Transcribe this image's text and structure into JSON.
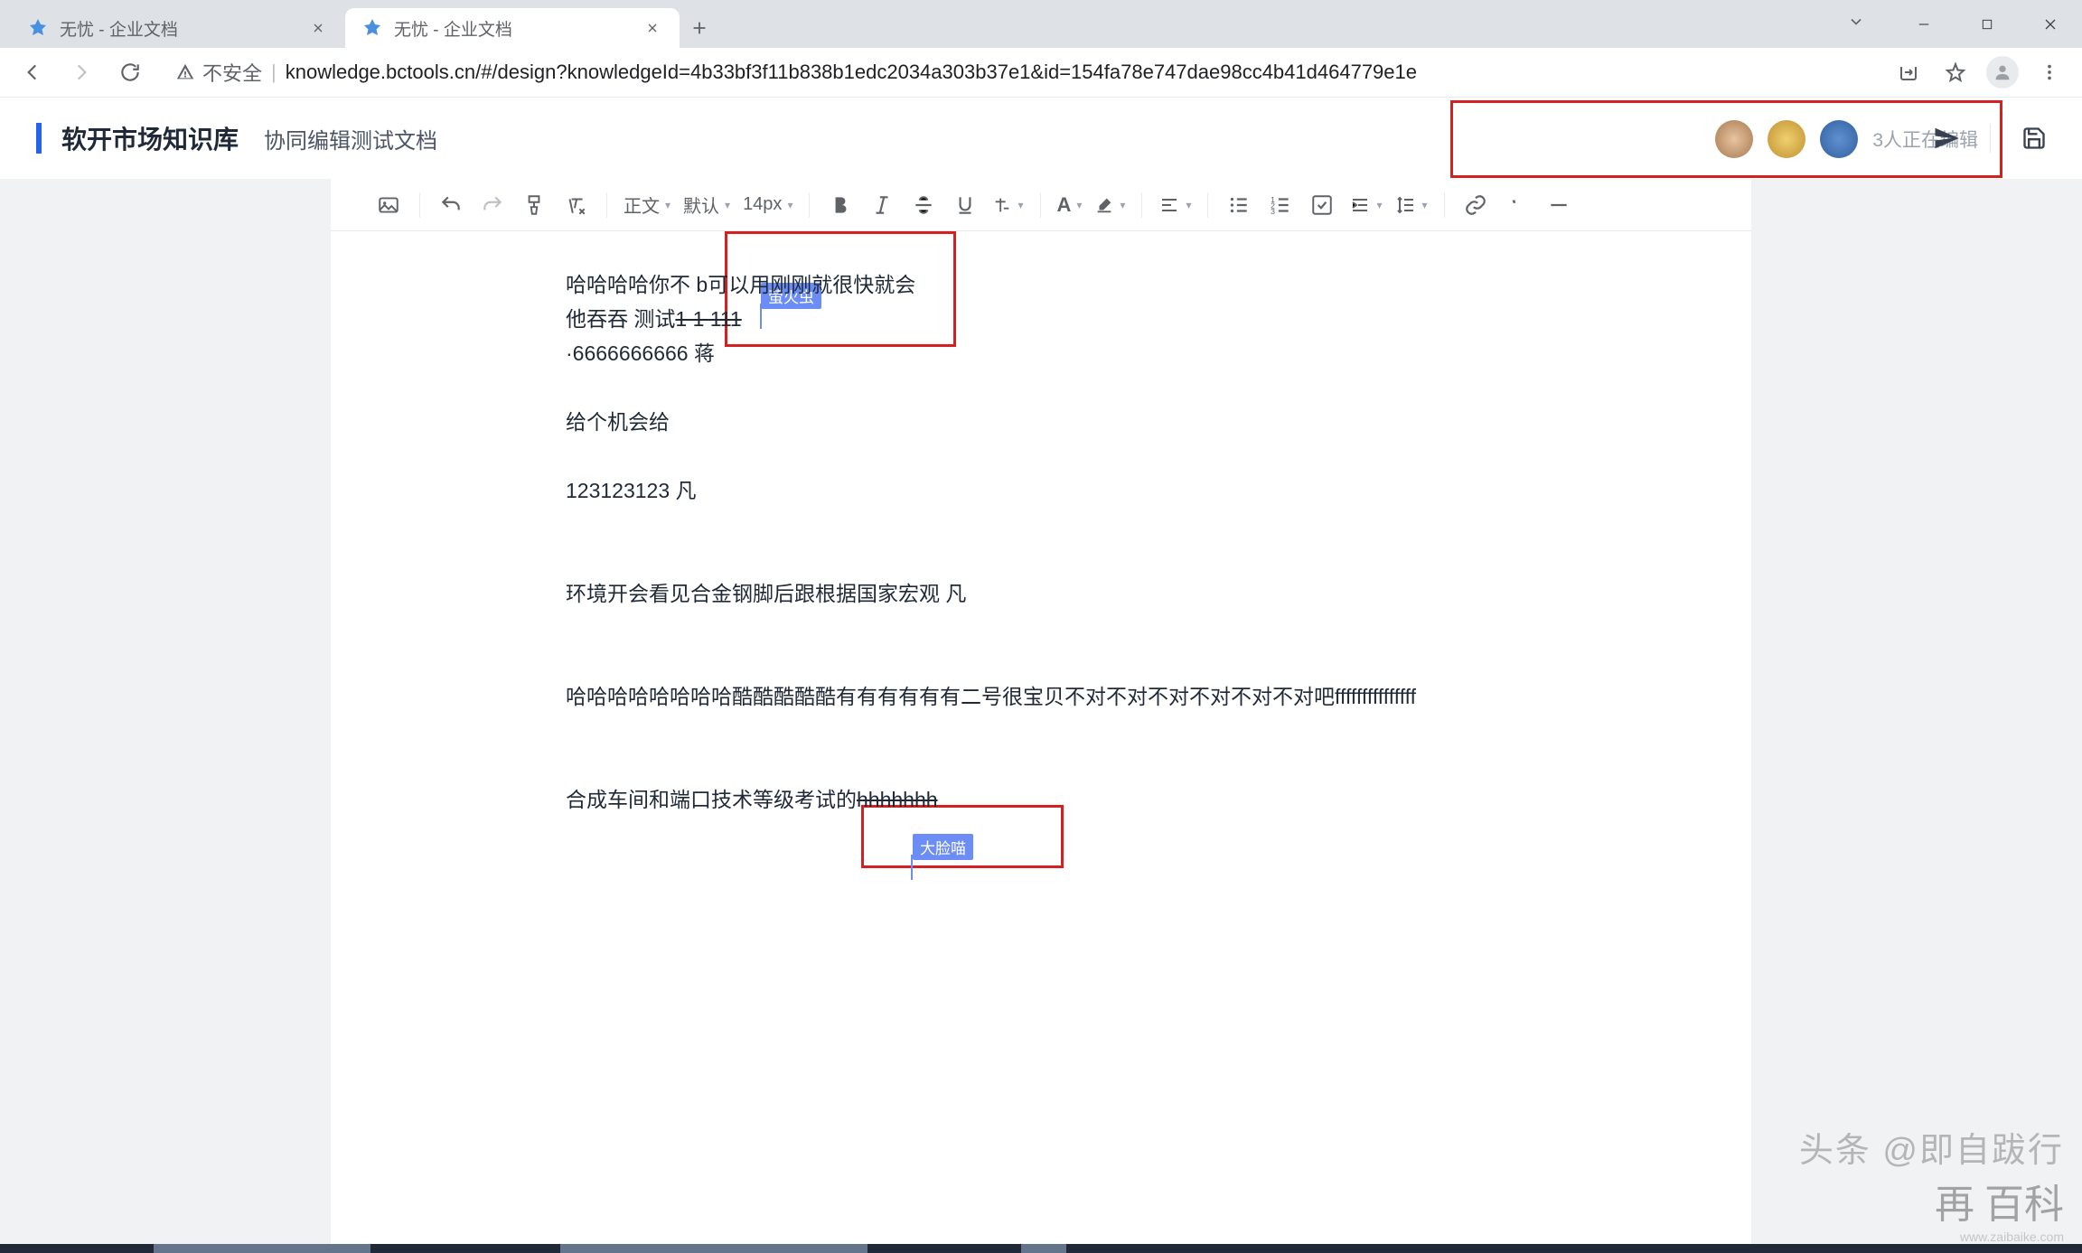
{
  "browser": {
    "tabs": [
      {
        "title": "无忧 - 企业文档",
        "active": false
      },
      {
        "title": "无忧 - 企业文档",
        "active": true
      }
    ],
    "url_warning": "不安全",
    "url": "knowledge.bctools.cn/#/design?knowledgeId=4b33bf3f11b838b1edc2034a303b37e1&id=154fa78e747dae98cc4b41d464779e1e"
  },
  "app": {
    "workspace_title": "软开市场知识库",
    "doc_name": "协同编辑测试文档",
    "collab_text": "3人正在编辑"
  },
  "toolbar": {
    "style_dd": "正文",
    "font_dd": "默认",
    "size_dd": "14px"
  },
  "cursors": {
    "tag1": "萤火虫",
    "tag2": "大脸喵"
  },
  "content": {
    "l1_a": "哈哈哈哈你不 b",
    "l1_b": "可以用刚刚就很快就会",
    "l2_a": "他吞吞   测试",
    "l2_b": "1   1   111",
    "l3": "·6666666666  蒋",
    "l4": "给个机会给",
    "l5": "123123123   凡",
    "l6": "环境开会看见合金钢脚后跟根据国家宏观   凡",
    "l7": "哈哈哈哈哈哈哈哈酷酷酷酷酷有有有有有有二号很宝贝不对不对不对不对不对不对吧fffffffffffffff",
    "l8_a": "合成车间和端口技术等级考试的",
    "l8_b": "hhhhhhh"
  },
  "watermark": {
    "line1": "头条 @即自跋行",
    "brand": "再 百科",
    "url": "www.zaibaike.com"
  }
}
